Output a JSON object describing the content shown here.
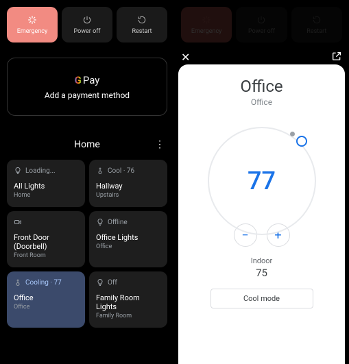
{
  "left": {
    "power": {
      "emergency": "Emergency",
      "poweroff": "Power off",
      "restart": "Restart"
    },
    "gpay": {
      "brand_g": "G",
      "brand_pay": "Pay",
      "sub": "Add a payment method"
    },
    "home": {
      "title": "Home"
    },
    "tiles": [
      {
        "status": "Loading...",
        "name": "All Lights",
        "room": "Home",
        "icon": "bulb"
      },
      {
        "status": "Cool · 76",
        "name": "Hallway",
        "room": "Upstairs",
        "icon": "thermo"
      },
      {
        "status": "",
        "name": "Front Door (Doorbell)",
        "room": "Front Room",
        "icon": "video"
      },
      {
        "status": "Offline",
        "name": "Office Lights",
        "room": "Office",
        "icon": "bulb"
      },
      {
        "status": "Cooling · 77",
        "name": "Office",
        "room": "Office",
        "icon": "thermo",
        "active": true
      },
      {
        "status": "Off",
        "name": "Family Room Lights",
        "room": "Family Room",
        "icon": "bulb"
      }
    ]
  },
  "right": {
    "power": {
      "emergency": "Emergency",
      "poweroff": "Power off",
      "restart": "Restart"
    },
    "sheet": {
      "title": "Office",
      "subtitle": "Office",
      "setpoint": "77",
      "indoor_label": "Indoor",
      "indoor_temp": "75",
      "mode": "Cool mode",
      "minus": "−",
      "plus": "+"
    }
  }
}
